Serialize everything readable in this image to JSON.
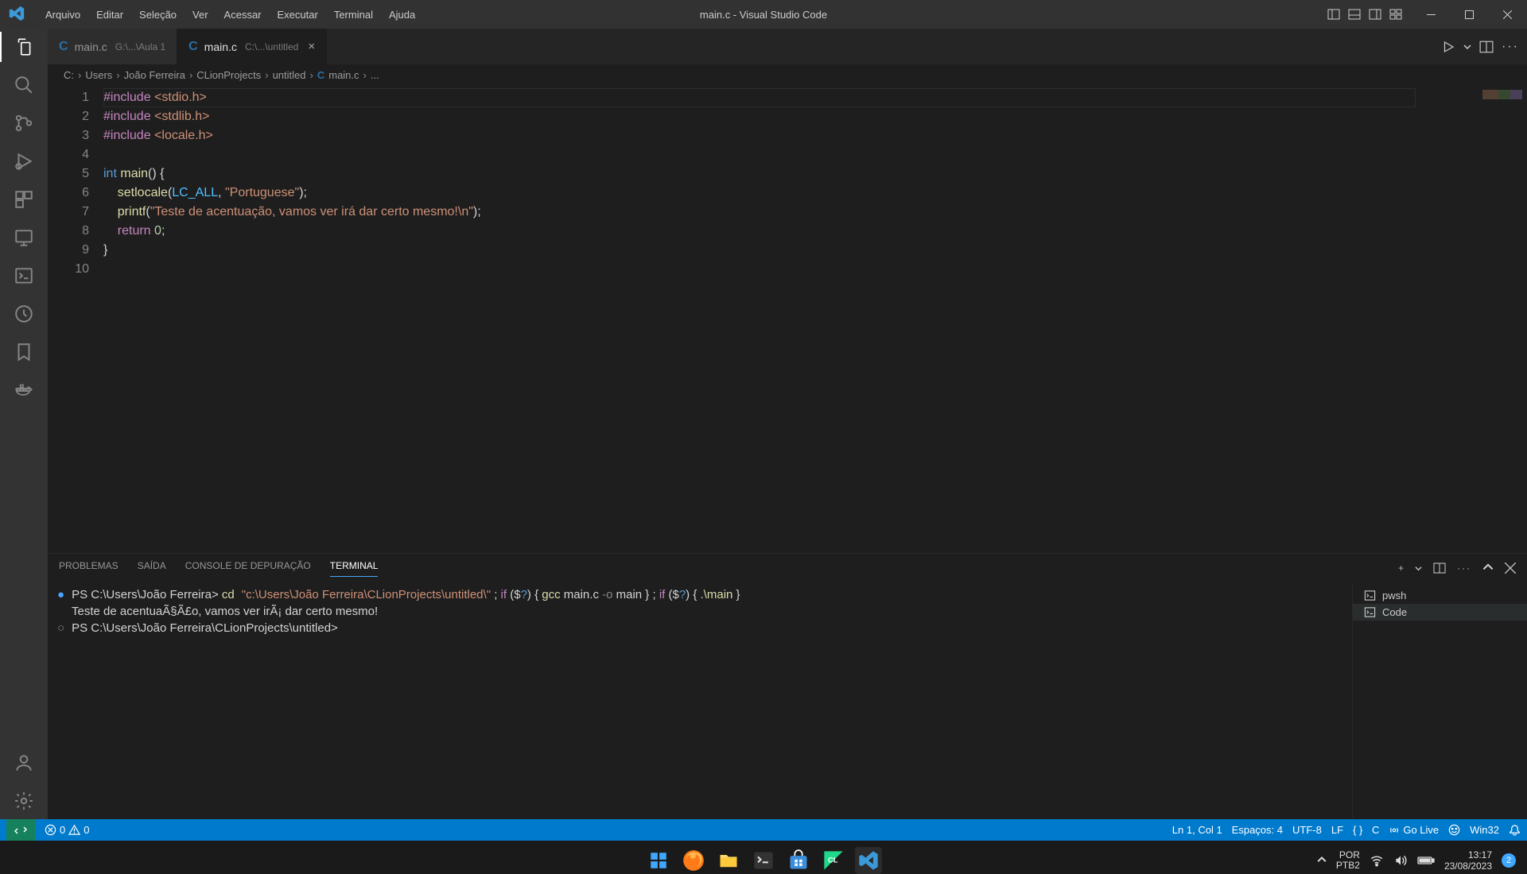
{
  "window": {
    "title": "main.c - Visual Studio Code"
  },
  "menu": [
    "Arquivo",
    "Editar",
    "Seleção",
    "Ver",
    "Acessar",
    "Executar",
    "Terminal",
    "Ajuda"
  ],
  "tabs": [
    {
      "name": "main.c",
      "path": "G:\\...\\Aula 1",
      "active": false
    },
    {
      "name": "main.c",
      "path": "C:\\...\\untitled",
      "active": true
    }
  ],
  "breadcrumb": [
    "C:",
    "Users",
    "João Ferreira",
    "CLionProjects",
    "untitled",
    "main.c",
    "..."
  ],
  "code": {
    "line_count": 10,
    "lines": [
      {
        "n": 1,
        "seg": [
          {
            "c": "tk-mag",
            "t": "#include "
          },
          {
            "c": "tk-inc",
            "t": "<stdio.h>"
          }
        ]
      },
      {
        "n": 2,
        "seg": [
          {
            "c": "tk-mag",
            "t": "#include "
          },
          {
            "c": "tk-inc",
            "t": "<stdlib.h>"
          }
        ]
      },
      {
        "n": 3,
        "seg": [
          {
            "c": "tk-mag",
            "t": "#include "
          },
          {
            "c": "tk-inc",
            "t": "<locale.h>"
          }
        ]
      },
      {
        "n": 4,
        "seg": []
      },
      {
        "n": 5,
        "seg": [
          {
            "c": "tk-kw",
            "t": "int"
          },
          {
            "c": "tk-pl",
            "t": " "
          },
          {
            "c": "tk-fn",
            "t": "main"
          },
          {
            "c": "tk-pl",
            "t": "() {"
          }
        ]
      },
      {
        "n": 6,
        "seg": [
          {
            "c": "tk-pl",
            "t": "    "
          },
          {
            "c": "tk-fn",
            "t": "setlocale"
          },
          {
            "c": "tk-pl",
            "t": "("
          },
          {
            "c": "tk-var",
            "t": "LC_ALL"
          },
          {
            "c": "tk-pl",
            "t": ", "
          },
          {
            "c": "tk-str",
            "t": "\"Portuguese\""
          },
          {
            "c": "tk-pl",
            "t": ");"
          }
        ]
      },
      {
        "n": 7,
        "seg": [
          {
            "c": "tk-pl",
            "t": "    "
          },
          {
            "c": "tk-fn",
            "t": "printf"
          },
          {
            "c": "tk-pl",
            "t": "("
          },
          {
            "c": "tk-str",
            "t": "\"Teste de acentuação, vamos ver irá dar certo mesmo!\\n\""
          },
          {
            "c": "tk-pl",
            "t": ");"
          }
        ]
      },
      {
        "n": 8,
        "seg": [
          {
            "c": "tk-pl",
            "t": "    "
          },
          {
            "c": "tk-mag",
            "t": "return"
          },
          {
            "c": "tk-pl",
            "t": " "
          },
          {
            "c": "tk-num",
            "t": "0"
          },
          {
            "c": "tk-pl",
            "t": ";"
          }
        ]
      },
      {
        "n": 9,
        "seg": [
          {
            "c": "tk-pl",
            "t": "}"
          }
        ]
      },
      {
        "n": 10,
        "seg": []
      }
    ]
  },
  "panel": {
    "tabs": [
      {
        "label": "PROBLEMAS",
        "active": false
      },
      {
        "label": "SAÍDA",
        "active": false
      },
      {
        "label": "CONSOLE DE DEPURAÇÃO",
        "active": false
      },
      {
        "label": "TERMINAL",
        "active": true
      }
    ]
  },
  "terminal": {
    "prompt1_ps": "PS C:\\Users\\João Ferreira> ",
    "cmd_cd": "cd",
    "cmd_path": "\"c:\\Users\\João Ferreira\\CLionProjects\\untitled\\\"",
    "sep1": " ; ",
    "if1": "if",
    "cond1": " ($",
    "cond1b": "?",
    "cond1c": ") { ",
    "gcc": "gcc",
    "gcc_args": " main.c ",
    "dash_o": "-o",
    "gcc_out": " main } ; ",
    "if2": "if",
    "cond2": " ($",
    "cond2b": "?",
    "cond2c": ") { ",
    "run": ".\\main",
    "run_end": " }",
    "output": "Teste de acentuaÃ§Ã£o, vamos ver irÃ¡ dar certo mesmo!",
    "prompt2": "PS C:\\Users\\João Ferreira\\CLionProjects\\untitled>",
    "side_items": [
      {
        "label": "pwsh",
        "active": false
      },
      {
        "label": "Code",
        "active": true
      }
    ]
  },
  "statusbar": {
    "errors": "0",
    "warnings": "0",
    "cursor": "Ln 1, Col 1",
    "spaces": "Espaços: 4",
    "encoding": "UTF-8",
    "eol": "LF",
    "lang": "C",
    "golive": "Go Live",
    "platform": "Win32"
  },
  "taskbar": {
    "lang1": "POR",
    "lang2": "PTB2",
    "time": "13:17",
    "date": "23/08/2023",
    "notif_count": "2"
  }
}
